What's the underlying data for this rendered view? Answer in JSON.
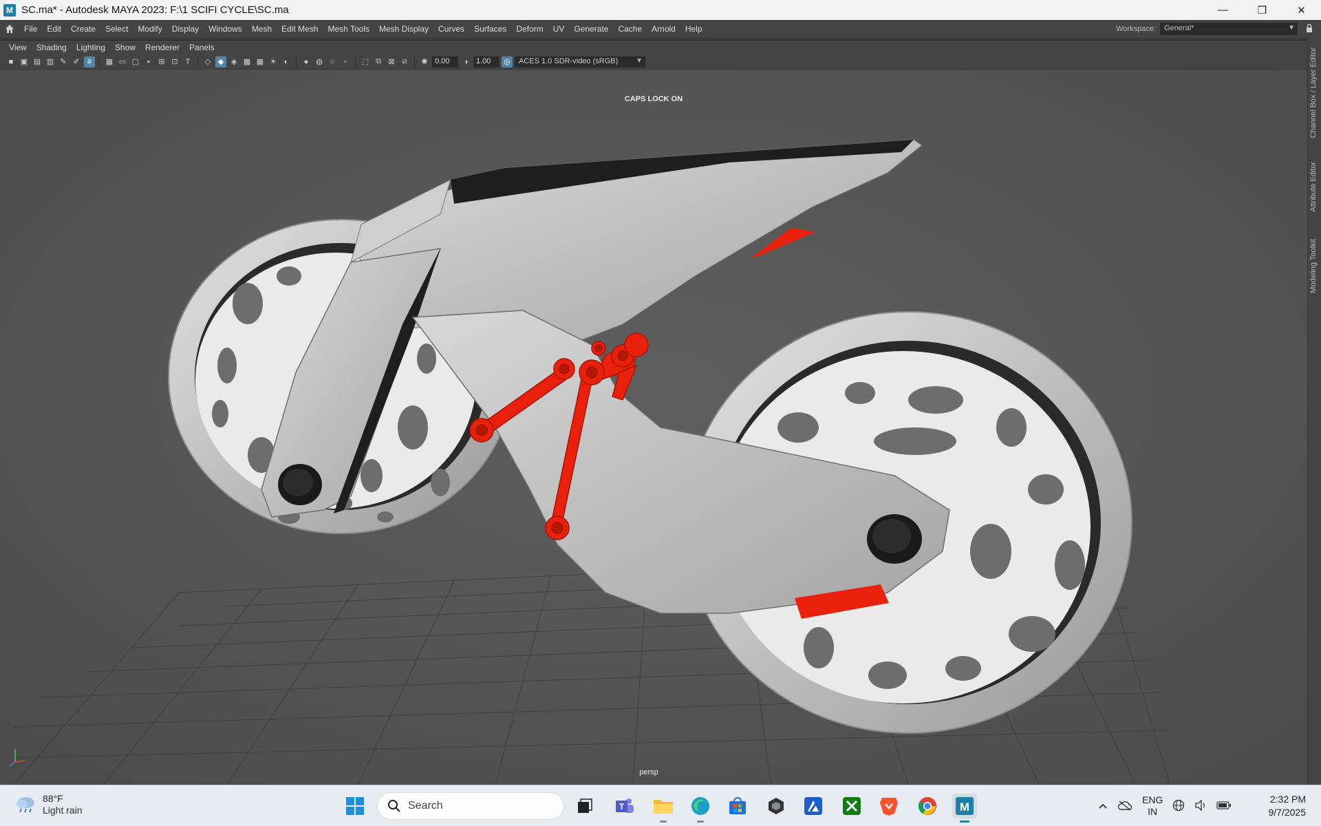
{
  "window": {
    "app_icon": "M",
    "title": "SC.ma* - Autodesk MAYA 2023: F:\\1 SCIFI CYCLE\\SC.ma",
    "minimize": "—",
    "restore": "❐",
    "close": "✕"
  },
  "menubar": {
    "items": [
      "File",
      "Edit",
      "Create",
      "Select",
      "Modify",
      "Display",
      "Windows",
      "Mesh",
      "Edit Mesh",
      "Mesh Tools",
      "Mesh Display",
      "Curves",
      "Surfaces",
      "Deform",
      "UV",
      "Generate",
      "Cache",
      "Arnold",
      "Help"
    ],
    "workspace_label": "Workspace:",
    "workspace_value": "General*"
  },
  "panel_menu": {
    "items": [
      "View",
      "Shading",
      "Lighting",
      "Show",
      "Renderer",
      "Panels"
    ]
  },
  "panel_toolbar": {
    "exposure_value": "0.00",
    "gamma_value": "1.00",
    "color_space": "ACES 1.0 SDR-video (sRGB)"
  },
  "viewport": {
    "caps_lock_message": "CAPS LOCK ON",
    "camera_name": "persp",
    "accent_red": "#e8200c",
    "model_gray": "#c8c8c8"
  },
  "side_tabs": [
    "Channel Box / Layer Editor",
    "Attribute Editor",
    "Modeling Toolkit"
  ],
  "taskbar": {
    "weather_temp": "88°F",
    "weather_condition": "Light rain",
    "search_placeholder": "Search",
    "language_line1": "ENG",
    "language_line2": "IN",
    "time": "2:32 PM",
    "date": "9/7/2025"
  }
}
